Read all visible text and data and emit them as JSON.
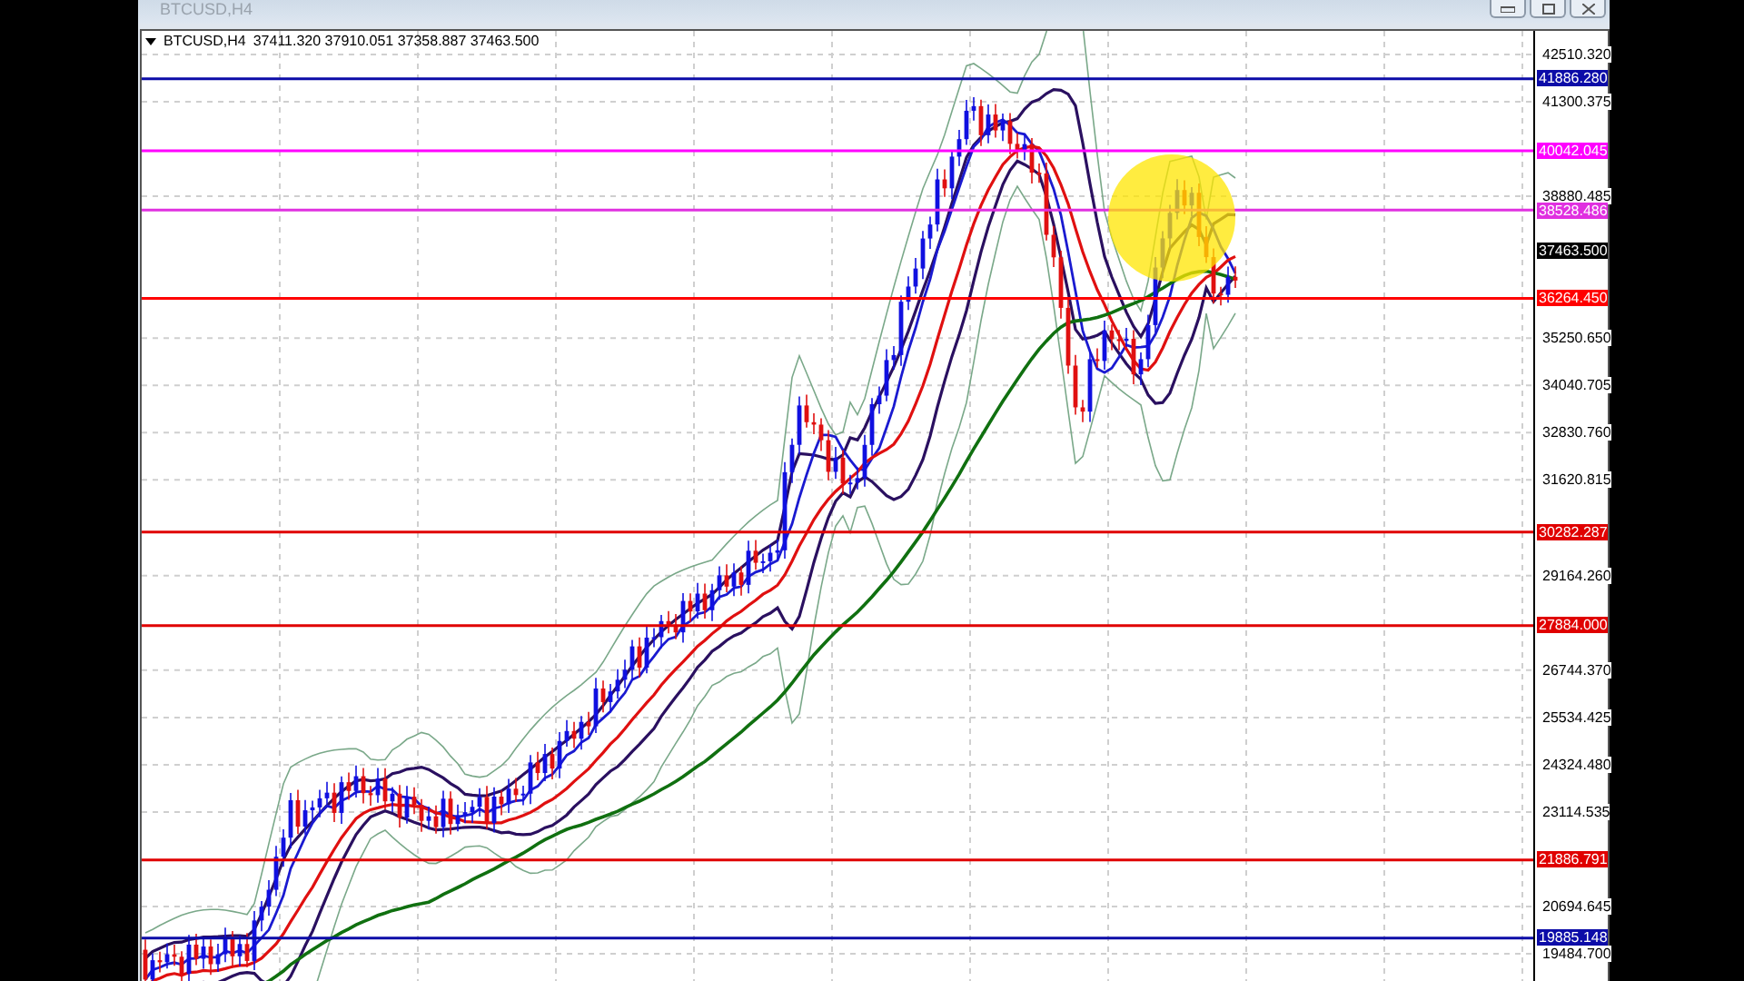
{
  "window": {
    "title": "BTCUSD,H4"
  },
  "chart_header": {
    "symbol": "BTCUSD,H4",
    "ohlc": "37411.320 37910.051 37358.887 37463.500"
  },
  "price_ticks": [
    "42510.320",
    "41300.375",
    "38880.485",
    "35250.650",
    "34040.705",
    "32830.760",
    "31620.815",
    "29164.260",
    "26744.370",
    "25534.425",
    "24324.480",
    "23114.535",
    "20694.645",
    "19484.700"
  ],
  "levels": [
    {
      "price": "41886.280",
      "color": "#0c0ca8"
    },
    {
      "price": "40042.045",
      "color": "#ff00ff"
    },
    {
      "price": "38528.486",
      "color": "#e030e0"
    },
    {
      "price": "36264.450",
      "color": "#ff0000"
    },
    {
      "price": "30282.287",
      "color": "#e00000"
    },
    {
      "price": "27884.000",
      "color": "#e00000"
    },
    {
      "price": "21886.791",
      "color": "#e00000"
    },
    {
      "price": "19885.148",
      "color": "#0c0ca8"
    }
  ],
  "current_price": "37463.500"
}
